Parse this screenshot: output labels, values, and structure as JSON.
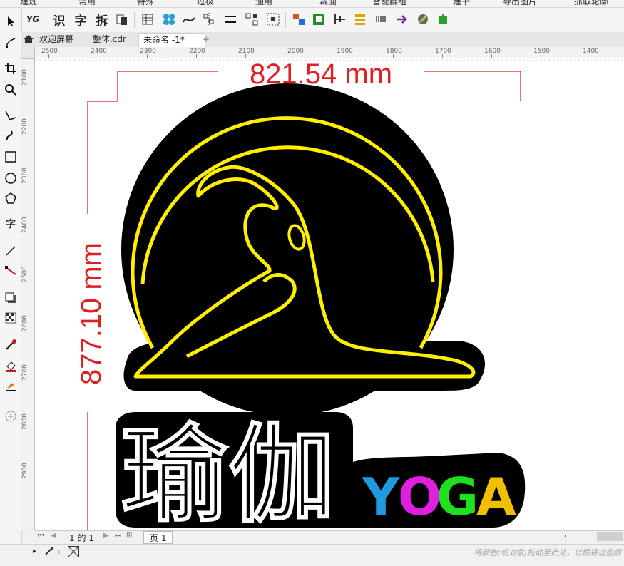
{
  "menu_strip": {
    "items": [
      "建规",
      "常用",
      "特殊",
      "过极",
      "通用",
      "裁面",
      "智能群组",
      "建书",
      "导出图片",
      "抓取轮廓"
    ]
  },
  "toolbar": {
    "text_buttons": [
      "识",
      "字",
      "拆"
    ]
  },
  "tabs": [
    {
      "label": "欢迎屏幕"
    },
    {
      "label": "整体.cdr"
    },
    {
      "label": "未命名 -1*"
    },
    {
      "label": "+"
    }
  ],
  "ruler": {
    "horizontal": [
      "2500",
      "2400",
      "2300",
      "2200",
      "2100",
      "2000",
      "1900",
      "1800",
      "1700",
      "1600",
      "1500",
      "1400"
    ],
    "vertical": [
      "2100",
      "2200",
      "2300",
      "2400",
      "2500",
      "2600",
      "2700",
      "2800",
      "2900"
    ]
  },
  "canvas": {
    "width_dimension": "821.54 mm",
    "height_dimension": "877.10 mm",
    "chinese_title": "瑜伽",
    "yoga_letters": [
      {
        "char": "Y",
        "color": "#1e9be0"
      },
      {
        "char": "O",
        "color": "#e020e0"
      },
      {
        "char": "G",
        "color": "#1ee01e"
      },
      {
        "char": "A",
        "color": "#f0c000"
      }
    ],
    "dimension_color": "#e02020",
    "neon_yellow": "#ffee00"
  },
  "pagebar": {
    "page_count": "1 的 1",
    "page_tab": "页 1"
  },
  "status": {
    "hint": "将颜色(或对象)拖动至此处，以便将这些颜"
  }
}
